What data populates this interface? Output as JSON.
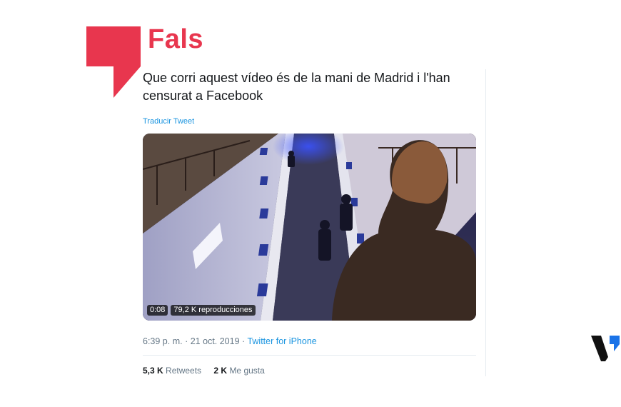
{
  "verdict": {
    "label": "Fals",
    "color": "#e8364e"
  },
  "tweet": {
    "text": "Que corri aquest vídeo és de la mani de Madrid i l'han censurat a Facebook",
    "translate_label": "Traducir Tweet",
    "video": {
      "duration": "0:08",
      "views": "79,2 K reproducciones"
    },
    "meta": {
      "time": "6:39 p. m.",
      "separator": "·",
      "date": "21 oct. 2019",
      "source": "Twitter for iPhone"
    },
    "stats": {
      "retweets_count": "5,3 K",
      "retweets_label": "Retweets",
      "likes_count": "2 K",
      "likes_label": "Me gusta"
    }
  },
  "colors": {
    "link": "#1b95e0",
    "muted_text": "#657786",
    "body_text": "#14171a",
    "brand_blue": "#1a73e8"
  },
  "icons": {
    "verdict_flag": "fals-flag-icon",
    "publisher": "verificat-logo-icon"
  }
}
